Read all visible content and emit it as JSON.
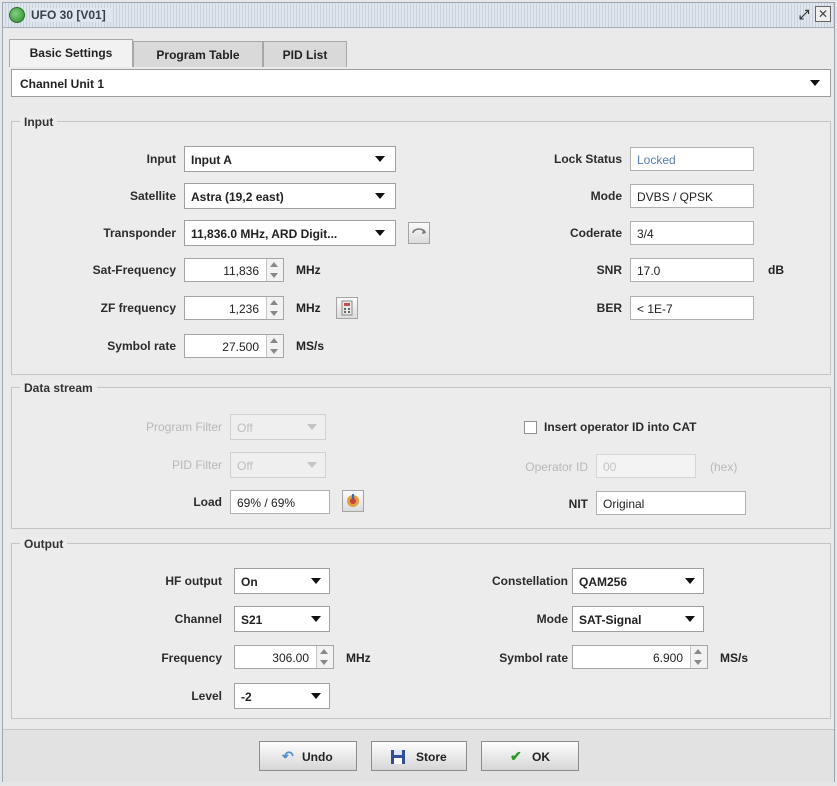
{
  "window": {
    "title": "UFO 30 [V01]"
  },
  "tabs": [
    {
      "label": "Basic Settings",
      "active": true
    },
    {
      "label": "Program Table",
      "active": false
    },
    {
      "label": "PID List",
      "active": false
    }
  ],
  "channel_unit": {
    "value": "Channel Unit 1"
  },
  "input_section": {
    "title": "Input",
    "input": {
      "label": "Input",
      "value": "Input A"
    },
    "satellite": {
      "label": "Satellite",
      "value": "Astra (19,2 east)"
    },
    "transponder": {
      "label": "Transponder",
      "value": "11,836.0 MHz, ARD Digit..."
    },
    "sat_frequency": {
      "label": "Sat-Frequency",
      "value": "11,836",
      "unit": "MHz"
    },
    "zf_frequency": {
      "label": "ZF frequency",
      "value": "1,236",
      "unit": "MHz"
    },
    "symbol_rate": {
      "label": "Symbol rate",
      "value": "27.500",
      "unit": "MS/s"
    },
    "lock_status": {
      "label": "Lock Status",
      "value": "Locked"
    },
    "mode": {
      "label": "Mode",
      "value": "DVBS / QPSK"
    },
    "coderate": {
      "label": "Coderate",
      "value": "3/4"
    },
    "snr": {
      "label": "SNR",
      "value": "17.0",
      "unit": "dB"
    },
    "ber": {
      "label": "BER",
      "value": "< 1E-7"
    }
  },
  "data_stream": {
    "title": "Data stream",
    "program_filter": {
      "label": "Program Filter",
      "value": "Off"
    },
    "pid_filter": {
      "label": "PID Filter",
      "value": "Off"
    },
    "load": {
      "label": "Load",
      "value": "69% / 69%"
    },
    "insert_operator": {
      "label": "Insert operator ID into CAT",
      "checked": false
    },
    "operator_id": {
      "label": "Operator ID",
      "value": "00",
      "unit": "(hex)"
    },
    "nit": {
      "label": "NIT",
      "value": "Original"
    }
  },
  "output_section": {
    "title": "Output",
    "hf_output": {
      "label": "HF output",
      "value": "On"
    },
    "channel": {
      "label": "Channel",
      "value": "S21"
    },
    "frequency": {
      "label": "Frequency",
      "value": "306.00",
      "unit": "MHz"
    },
    "level": {
      "label": "Level",
      "value": "-2"
    },
    "constellation": {
      "label": "Constellation",
      "value": "QAM256"
    },
    "mode": {
      "label": "Mode",
      "value": "SAT-Signal"
    },
    "symbol_rate": {
      "label": "Symbol rate",
      "value": "6.900",
      "unit": "MS/s"
    }
  },
  "buttons": {
    "undo": "Undo",
    "store": "Store",
    "ok": "OK"
  },
  "colors": {
    "locked_text": "#5a7bb5",
    "ok_check": "#2e9a2e",
    "store_icon": "#2f4f9e"
  }
}
